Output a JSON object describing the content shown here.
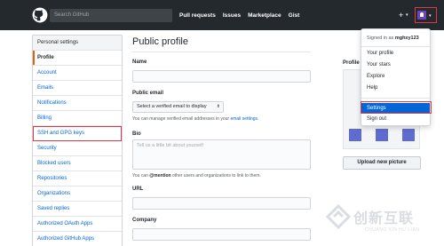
{
  "topbar": {
    "search_placeholder": "Search GitHub",
    "nav": [
      "Pull requests",
      "Issues",
      "Marketplace",
      "Gist"
    ],
    "plus": "+",
    "caret": "▾"
  },
  "sidebar": {
    "heading": "Personal settings",
    "items": [
      {
        "label": "Profile",
        "selected": true
      },
      {
        "label": "Account"
      },
      {
        "label": "Emails"
      },
      {
        "label": "Notifications"
      },
      {
        "label": "Billing"
      },
      {
        "label": "SSH and GPG keys",
        "highlighted": true
      },
      {
        "label": "Security"
      },
      {
        "label": "Blocked users"
      },
      {
        "label": "Repositories"
      },
      {
        "label": "Organizations"
      },
      {
        "label": "Saved replies"
      },
      {
        "label": "Authorized OAuth Apps"
      },
      {
        "label": "Authorized GitHub Apps"
      }
    ]
  },
  "main": {
    "title": "Public profile",
    "name_label": "Name",
    "email_label": "Public email",
    "email_select": "Select a verified email to display",
    "email_note_pre": "You can manage verified email addresses in your",
    "email_note_link": "email settings",
    "email_note_post": ".",
    "bio_label": "Bio",
    "bio_placeholder": "Tell us a little bit about yourself",
    "bio_note_pre": "You can",
    "bio_note_mention": "@mention",
    "bio_note_post": "other users and organizations to link to them.",
    "url_label": "URL",
    "company_label": "Company"
  },
  "profile_picture": {
    "label": "Profile picture",
    "upload_label": "Upload new picture",
    "identicon_color": "#5e6ccf"
  },
  "dropdown": {
    "signed_in_pre": "Signed in as",
    "username": "mghxy123",
    "items": [
      "Your profile",
      "Your stars",
      "Explore",
      "Help"
    ],
    "settings": "Settings",
    "sign_out": "Sign out"
  },
  "watermark": {
    "cn": "创新互联",
    "en": "CHUANG XIN HU LIAN"
  },
  "colors": {
    "header": "#24292e",
    "link": "#0366d6",
    "highlight_outline": "#d73a49",
    "selected_accent": "#e36209"
  }
}
